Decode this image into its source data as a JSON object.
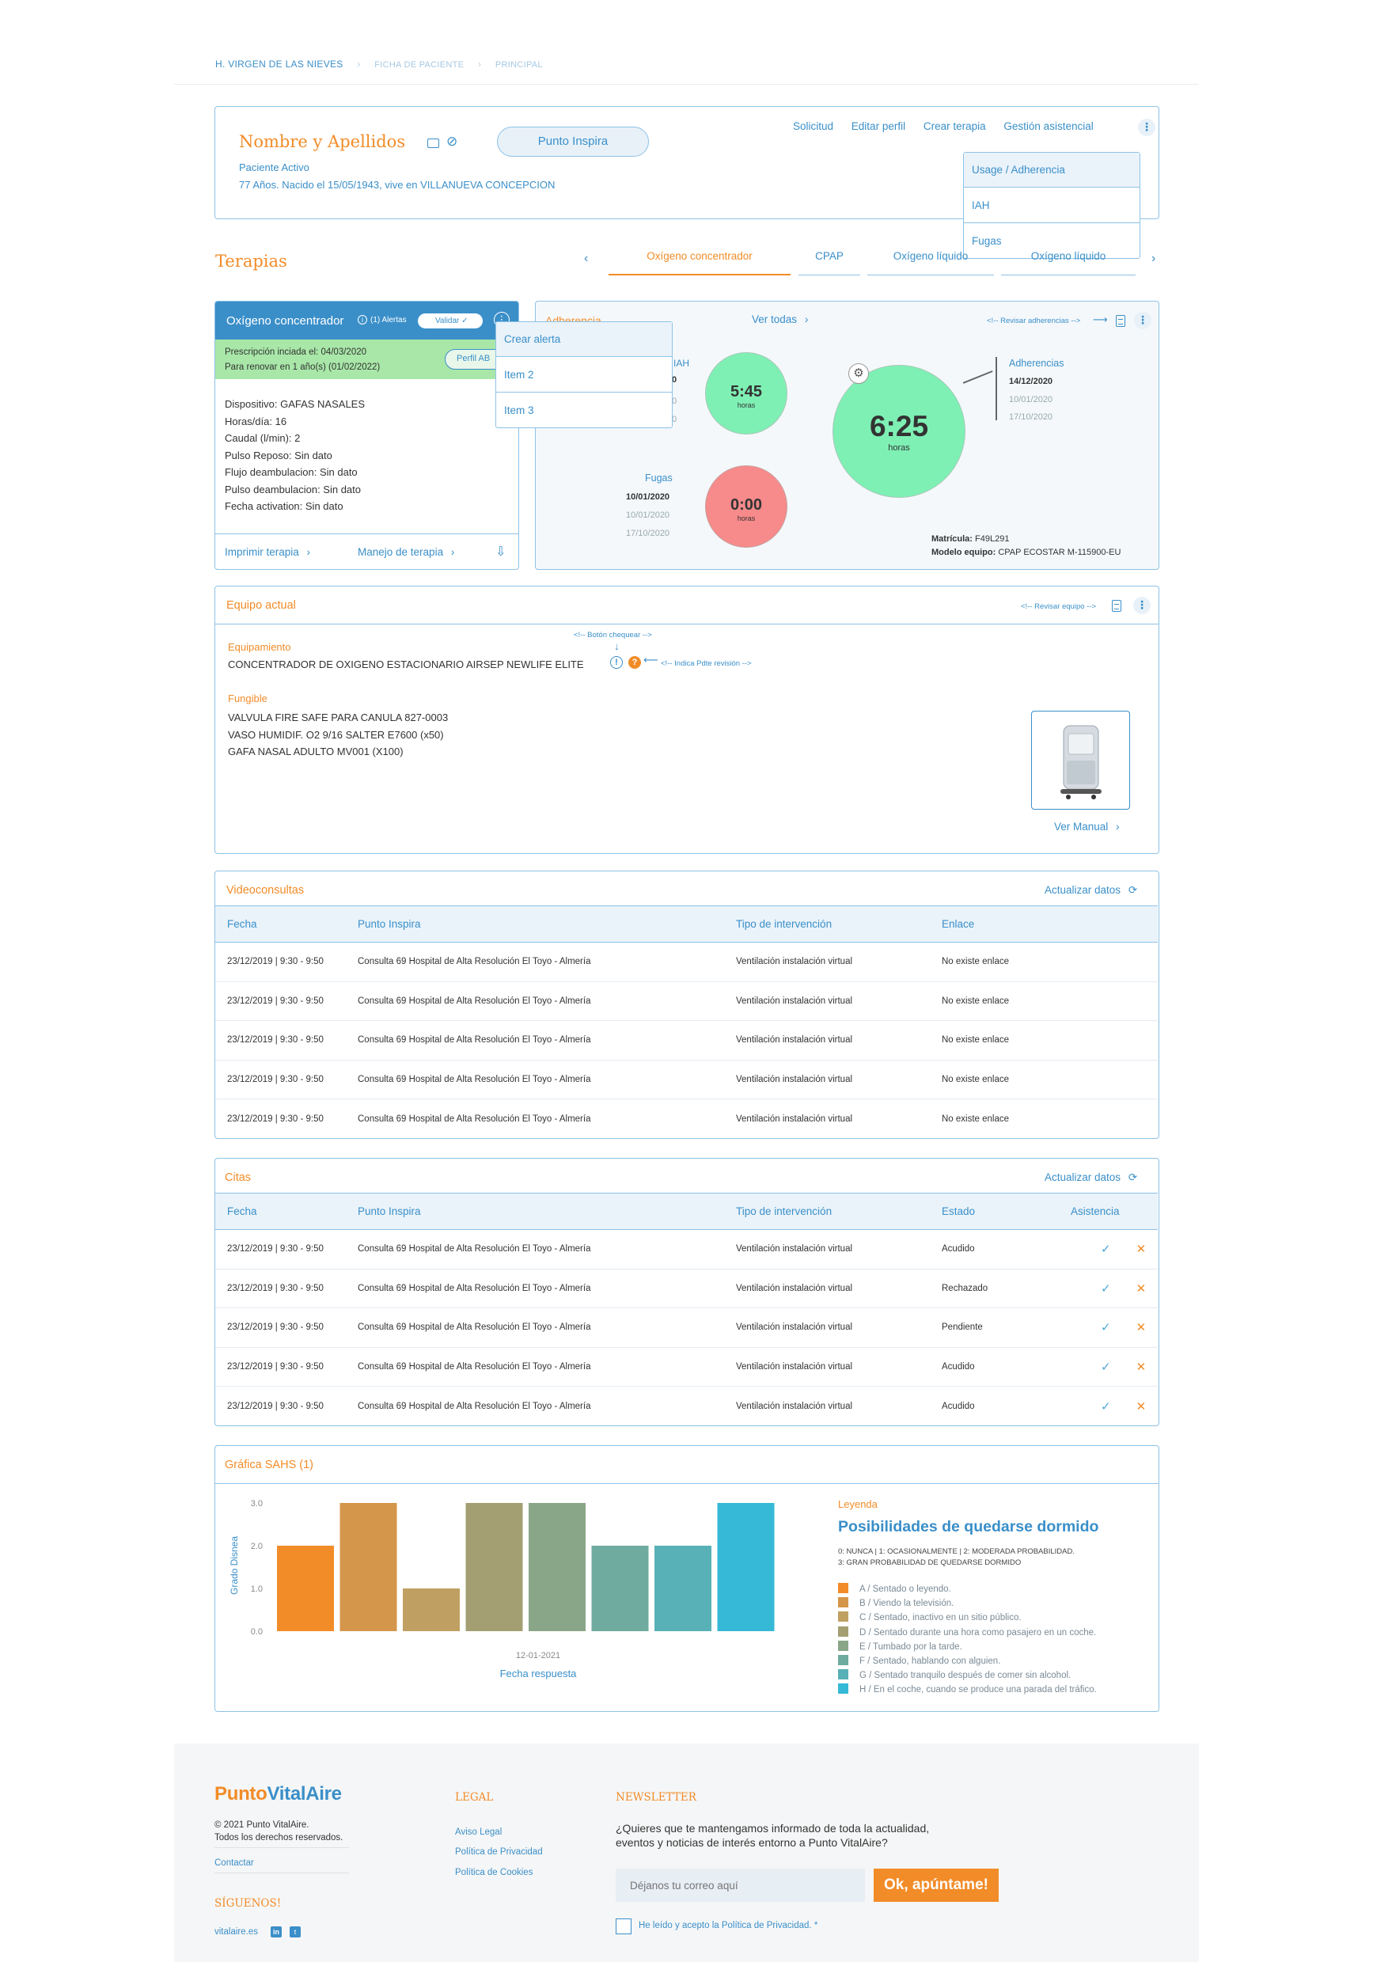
{
  "breadcrumb": {
    "items": [
      "H. VIRGEN DE LAS NIEVES",
      "FICHA DE PACIENTE",
      "PRINCIPAL"
    ]
  },
  "patient": {
    "name": "Nombre y Apellidos",
    "point_button": "Punto Inspira",
    "status": "Paciente Activo",
    "details": "77 Años. Nacido el 15/05/1943, vive en VILLANUEVA CONCEPCION",
    "actions": [
      "Solicitud",
      "Editar perfil",
      "Crear terapia",
      "Gestión asistencial"
    ],
    "dropdown": [
      "Usage / Adherencia",
      "IAH",
      "Fugas"
    ]
  },
  "therapies": {
    "title": "Terapias",
    "tabs": [
      "Oxígeno concentrador",
      "CPAP",
      "Oxígeno líquido",
      "Oxígeno líquido"
    ],
    "active_tab": 0
  },
  "therapy_card": {
    "title": "Oxígeno concentrador",
    "alerts": "(1) Alertas",
    "validate": "Validar",
    "prescription_line1": "Prescripción inciada el: 04/03/2020",
    "prescription_line2": "Para renovar en 1 año(s) (01/02/2022)",
    "profile_button": "Perfil AB",
    "details": [
      "Dispositivo: GAFAS NASALES",
      "Horas/día: 16",
      "Caudal (l/min): 2",
      "Pulso Reposo: Sin dato",
      "Flujo deambulacion: Sin dato",
      "Pulso deambulacion: Sin dato",
      "Fecha activation: Sin dato"
    ],
    "print_link": "Imprimir terapia",
    "handle_link": "Manejo de terapia",
    "menu": [
      "Crear alerta",
      "Item 2",
      "Item 3"
    ]
  },
  "adherence": {
    "title": "Adherencia",
    "see_all": "Ver todas",
    "review_note": "<!-- Revisar adherencias -->",
    "iah_label": "IAH",
    "iah_value": "5:45",
    "iah_unit": "horas",
    "main_value": "6:25",
    "main_unit": "horas",
    "adh_label": "Adherencias",
    "adh_dates": [
      "14/12/2020",
      "10/01/2020",
      "17/10/2020"
    ],
    "leaks_label": "Fugas",
    "leaks_dates": [
      "10/01/2020",
      "10/01/2020",
      "17/10/2020"
    ],
    "leaks_value": "0:00",
    "leaks_unit": "horas",
    "plate_label": "Matrícula:",
    "plate_value": "F49L291",
    "model_label": "Modelo equipo:",
    "model_value": "CPAP ECOSTAR M-115900-EU",
    "colors": {
      "green": "#7ef0b4",
      "red": "#f78a8a"
    }
  },
  "equipment": {
    "title": "Equipo actual",
    "review_note": "<!-- Revisar equipo -->",
    "check_note": "<!-- Botón chequear -->",
    "pending_note": "<!-- Indica Pdte revisión -->",
    "equip_label": "Equipamiento",
    "equip_item": "CONCENTRADOR DE OXIGENO ESTACIONARIO AIRSEP NEWLIFE ELITE",
    "fungible_label": "Fungible",
    "fungible_items": [
      "VALVULA FIRE SAFE PARA CANULA 827-0003",
      "VASO HUMIDIF. O2 9/16 SALTER E7600 (x50)",
      "GAFA NASAL ADULTO MV001 (X100)"
    ],
    "manual_link": "Ver Manual"
  },
  "video": {
    "title": "Videoconsultas",
    "refresh": "Actualizar datos",
    "columns": [
      "Fecha",
      "Punto Inspira",
      "Tipo de intervención",
      "Enlace"
    ],
    "rows": [
      [
        "23/12/2019 | 9:30 - 9:50",
        "Consulta 69 Hospital de Alta Resolución El Toyo - Almería",
        "Ventilación instalación virtual",
        "No existe enlace"
      ],
      [
        "23/12/2019 | 9:30 - 9:50",
        "Consulta 69 Hospital de Alta Resolución El Toyo - Almería",
        "Ventilación instalación virtual",
        "No existe enlace"
      ],
      [
        "23/12/2019 | 9:30 - 9:50",
        "Consulta 69 Hospital de Alta Resolución El Toyo - Almería",
        "Ventilación instalación virtual",
        "No existe enlace"
      ],
      [
        "23/12/2019 | 9:30 - 9:50",
        "Consulta 69 Hospital de Alta Resolución El Toyo - Almería",
        "Ventilación instalación virtual",
        "No existe enlace"
      ],
      [
        "23/12/2019 | 9:30 - 9:50",
        "Consulta 69 Hospital de Alta Resolución El Toyo - Almería",
        "Ventilación instalación virtual",
        "No existe enlace"
      ]
    ]
  },
  "appointments": {
    "title": "Citas",
    "refresh": "Actualizar datos",
    "columns": [
      "Fecha",
      "Punto Inspira",
      "Tipo de intervención",
      "Estado",
      "Asistencia"
    ],
    "rows": [
      [
        "23/12/2019 | 9:30 - 9:50",
        "Consulta 69 Hospital de Alta Resolución El Toyo - Almería",
        "Ventilación instalación virtual",
        "Acudido"
      ],
      [
        "23/12/2019 | 9:30 - 9:50",
        "Consulta 69 Hospital de Alta Resolución El Toyo - Almería",
        "Ventilación instalación virtual",
        "Rechazado"
      ],
      [
        "23/12/2019 | 9:30 - 9:50",
        "Consulta 69 Hospital de Alta Resolución El Toyo - Almería",
        "Ventilación instalación virtual",
        "Pendiente"
      ],
      [
        "23/12/2019 | 9:30 - 9:50",
        "Consulta 69 Hospital de Alta Resolución El Toyo - Almería",
        "Ventilación instalación virtual",
        "Acudido"
      ],
      [
        "23/12/2019 | 9:30 - 9:50",
        "Consulta 69 Hospital de Alta Resolución El Toyo - Almería",
        "Ventilación instalación virtual",
        "Acudido"
      ]
    ]
  },
  "sahs": {
    "title": "Gráfica SAHS (1)",
    "legend_label": "Leyenda",
    "legend_title": "Posibilidades de quedarse dormido",
    "legend_scale_1": "0: NUNCA | 1: OCASIONALMENTE | 2: MODERADA PROBABILIDAD.",
    "legend_scale_2": "3: GRAN PROBABILIDAD DE QUEDARSE DORMIDO",
    "legend_items": [
      "A / Sentado o leyendo.",
      "B / Viendo la televisión.",
      "C / Sentado, inactivo en un sitio público.",
      "D / Sentado durante una hora como pasajero en un coche.",
      "E / Tumbado por la tarde.",
      "F / Sentado, hablando con alguien.",
      "G / Sentado tranquilo después de comer sin alcohol.",
      "H / En el coche, cuando se produce una parada del tráfico."
    ]
  },
  "chart_data": {
    "type": "bar",
    "categories": [
      "A",
      "B",
      "C",
      "D",
      "E",
      "F",
      "G",
      "H"
    ],
    "values": [
      2,
      3,
      1,
      3,
      3,
      2,
      2,
      3
    ],
    "colors": [
      "#f28c28",
      "#d4964a",
      "#c0a062",
      "#a39f73",
      "#8aa688",
      "#6fab9e",
      "#58b1b6",
      "#35b9d6"
    ],
    "ylabel": "Grado Disnea",
    "xlabel": "Fecha respuesta",
    "x_tick": "12-01-2021",
    "yticks": [
      "0.0",
      "1.0",
      "2.0",
      "3.0"
    ],
    "ylim": [
      0,
      3
    ]
  },
  "footer": {
    "brand_a": "Punto",
    "brand_b": "VitalAire",
    "copyright_1": "© 2021 Punto VitalAire.",
    "copyright_2": "Todos los derechos reservados.",
    "contact": "Contactar",
    "follow": "SÍGUENOS!",
    "site": "vitalaire.es",
    "legal_title": "LEGAL",
    "legal_links": [
      "Aviso Legal",
      "Política de Privacidad",
      "Política de Cookies"
    ],
    "newsletter_title": "NEWSLETTER",
    "newsletter_text_1": "¿Quieres que te mantengamos informado de toda la actualidad,",
    "newsletter_text_2": "eventos y noticias de interés entorno a Punto VitalAire?",
    "email_placeholder": "Déjanos tu correo aquí",
    "subscribe": "Ok, apúntame!",
    "privacy_check": "He leído y acepto la Política de Privacidad. *"
  }
}
